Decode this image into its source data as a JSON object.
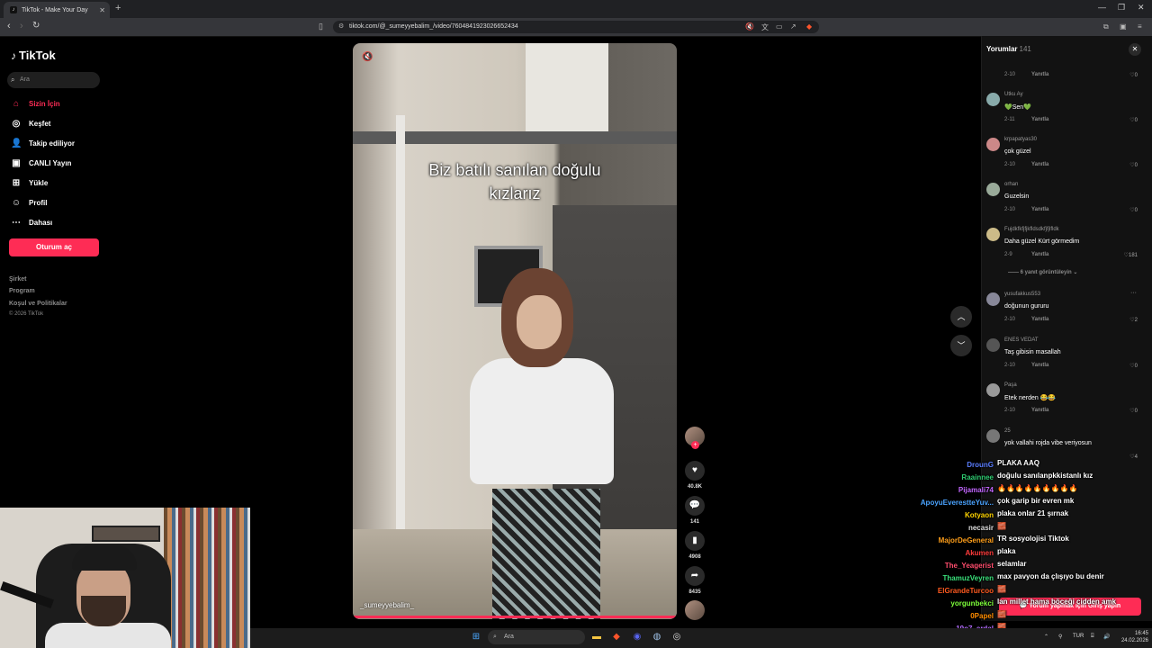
{
  "browser": {
    "tab_title": "TikTok - Make Your Day",
    "url": "tiktok.com/@_sumeyyebalim_/video/7604841923026652434"
  },
  "sidebar": {
    "logo": "TikTok",
    "search_placeholder": "Ara",
    "items": [
      {
        "label": "Sizin İçin",
        "icon": "home-icon",
        "active": true
      },
      {
        "label": "Keşfet",
        "icon": "compass-icon"
      },
      {
        "label": "Takip ediliyor",
        "icon": "user-follow-icon"
      },
      {
        "label": "CANLI Yayın",
        "icon": "live-icon"
      },
      {
        "label": "Yükle",
        "icon": "upload-icon"
      },
      {
        "label": "Profil",
        "icon": "profile-icon"
      },
      {
        "label": "Dahası",
        "icon": "more-icon"
      }
    ],
    "login_button": "Oturum aç",
    "footer": [
      "Şirket",
      "Program",
      "Koşul ve Politikalar"
    ],
    "copyright": "© 2026 TikTok"
  },
  "video": {
    "caption_line1": "Biz batılı sanılan doğulu",
    "caption_line2": "kızlarız",
    "username": "_sumeyyebalim_",
    "likes": "40.8K",
    "comments": "141",
    "saves": "4908",
    "shares": "8435"
  },
  "comments": {
    "title": "Yorumlar",
    "count": "141",
    "reply_label": "Yanıtla",
    "view_replies": "6 yanıt görüntüleyin",
    "items": [
      {
        "user": "",
        "text": "",
        "date": "2-10",
        "likes": "0"
      },
      {
        "user": "Utku Ay",
        "text": "💚Sen💚",
        "date": "2-11",
        "likes": "0"
      },
      {
        "user": "krpapatyas30",
        "text": "çok güzel",
        "date": "2-10",
        "likes": "0"
      },
      {
        "user": "orhan",
        "text": "Guzelsin",
        "date": "2-10",
        "likes": "0"
      },
      {
        "user": "Fujdkfkfjfjkfldsdkfjfjlfldk",
        "text": "Daha güzel Kürt görmedim",
        "date": "2-9",
        "likes": "181"
      },
      {
        "user": "yusufakkus553",
        "text": "doğunun gururu",
        "date": "2-10",
        "likes": "2"
      },
      {
        "user": "ENES VEDAT",
        "text": "Taş gibisin masallah",
        "date": "2-10",
        "likes": "0"
      },
      {
        "user": "Paşa",
        "text": "Etek nerden 😂😂",
        "date": "2-10",
        "likes": "0"
      },
      {
        "user": "25",
        "text": "yok vallahi rojda vibe veriyosun",
        "date": "",
        "likes": "4"
      }
    ],
    "login_prompt": "Yorum yapmak için Giriş yapın"
  },
  "chat": [
    {
      "name": "DrounG",
      "color": "#5a7dff",
      "msg": "PLAKA AAQ"
    },
    {
      "name": "Raainnee",
      "color": "#2ecc71",
      "msg": "doğulu sanılanpkkistanlı kız"
    },
    {
      "name": "Pijamali74",
      "color": "#c266ff",
      "msg": "🔥🔥🔥🔥🔥🔥🔥🔥🔥"
    },
    {
      "name": "ApoyuEverestteYuv...",
      "color": "#4aa3ff",
      "msg": "çok garip bir evren mk"
    },
    {
      "name": "Kotyaon",
      "color": "#ffd400",
      "msg": "plaka onlar 21 şırnak"
    },
    {
      "name": "necasir",
      "color": "#dddddd",
      "msg": "🧱"
    },
    {
      "name": "MajorDeGeneral",
      "color": "#ff9f1a",
      "msg": "TR sosyolojisi Tiktok"
    },
    {
      "name": "Akumen",
      "color": "#ff3b3b",
      "msg": "plaka"
    },
    {
      "name": "The_Yeagerist",
      "color": "#ff4d6d",
      "msg": "selamlar"
    },
    {
      "name": "ThamuzVeyren",
      "color": "#39e07a",
      "msg": "max pavyon da çlışıyo bu denir"
    },
    {
      "name": "ElGrandeTurcoo",
      "color": "#ff5a1f",
      "msg": "🧱"
    },
    {
      "name": "yorgunbekci",
      "color": "#7dff3a",
      "msg": "lan millet hama böceği cidden amk"
    },
    {
      "name": "0Papel",
      "color": "#ff8c00",
      "msg": "🧱"
    },
    {
      "name": "19o7_erdal",
      "color": "#b36bff",
      "msg": "🧱"
    },
    {
      "name": "merveli",
      "color": "#8fb3ff",
      "msg": ""
    }
  ],
  "taskbar": {
    "search_placeholder": "Ara",
    "lang": "TUR",
    "time": "16:45",
    "date": "24.02.2026"
  }
}
